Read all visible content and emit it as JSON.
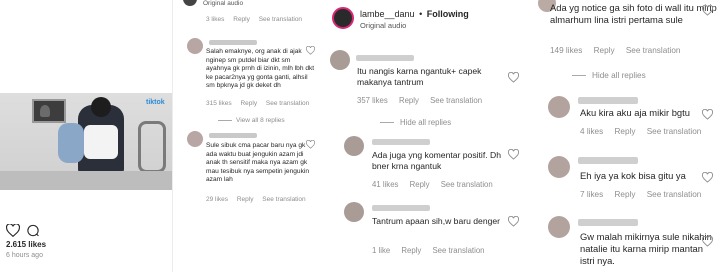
{
  "panel1": {
    "video_brand": "tiktok",
    "likes_total": "2.615 likes",
    "time_ago": "6 hours ago"
  },
  "panel2": {
    "header_audio": "Original audio",
    "top_meta": {
      "likes": "3 likes",
      "reply": "Reply",
      "see_translation": "See translation"
    },
    "comments": [
      {
        "text": "Salah emaknye, org anak di ajak nginep sm putdel biar dkt sm ayahnya gk prnh di izinin, mlh lbh dkt ke pacar2nya yg gonta ganti, alhsil sm bpknya jd gk deket dh",
        "likes": "315 likes",
        "reply": "Reply",
        "see_translation": "See translation"
      },
      {
        "text": "Sule sibuk cma pacar baru nya gk ada waktu buat jengukin azam jdi anak th sensitif maka nya azam gk mau tesibuk nya sempetin jengukin azam lah",
        "likes": "29 likes",
        "reply": "Reply",
        "see_translation": "See translation"
      }
    ],
    "view_replies": "View all 8 replies"
  },
  "panel3": {
    "account": "lambe__danu",
    "dot": "•",
    "follow_label": "Following",
    "audio": "Original audio",
    "comments": [
      {
        "text": "Itu nangis karna ngantuk+ capek makanya tantrum",
        "likes": "357 likes",
        "reply": "Reply",
        "see_translation": "See translation"
      },
      {
        "text": "Ada juga yng komentar positif. Dh bner krna ngantuk",
        "likes": "41 likes",
        "reply": "Reply",
        "see_translation": "See translation"
      },
      {
        "text": "Tantrum apaan sih,w baru denger",
        "likes": "1 like",
        "reply": "Reply",
        "see_translation": "See translation"
      }
    ],
    "hide_replies": "Hide all replies"
  },
  "panel4": {
    "top_comment": {
      "text": "Ada yg notice ga sih foto di wall itu mirip almarhum lina istri pertama sule",
      "likes": "149 likes",
      "reply": "Reply",
      "see_translation": "See translation"
    },
    "hide_replies": "Hide all replies",
    "comments": [
      {
        "text": "Aku kira aku aja mikir bgtu",
        "likes": "4 likes",
        "reply": "Reply",
        "see_translation": "See translation"
      },
      {
        "text": "Eh iya ya kok bisa gitu ya",
        "likes": "7 likes",
        "reply": "Reply",
        "see_translation": "See translation"
      },
      {
        "text": "Gw malah mikirnya sule nikahin natalie itu karna mirip mantan istri nya.",
        "likes": "",
        "reply": "",
        "see_translation": ""
      }
    ]
  }
}
